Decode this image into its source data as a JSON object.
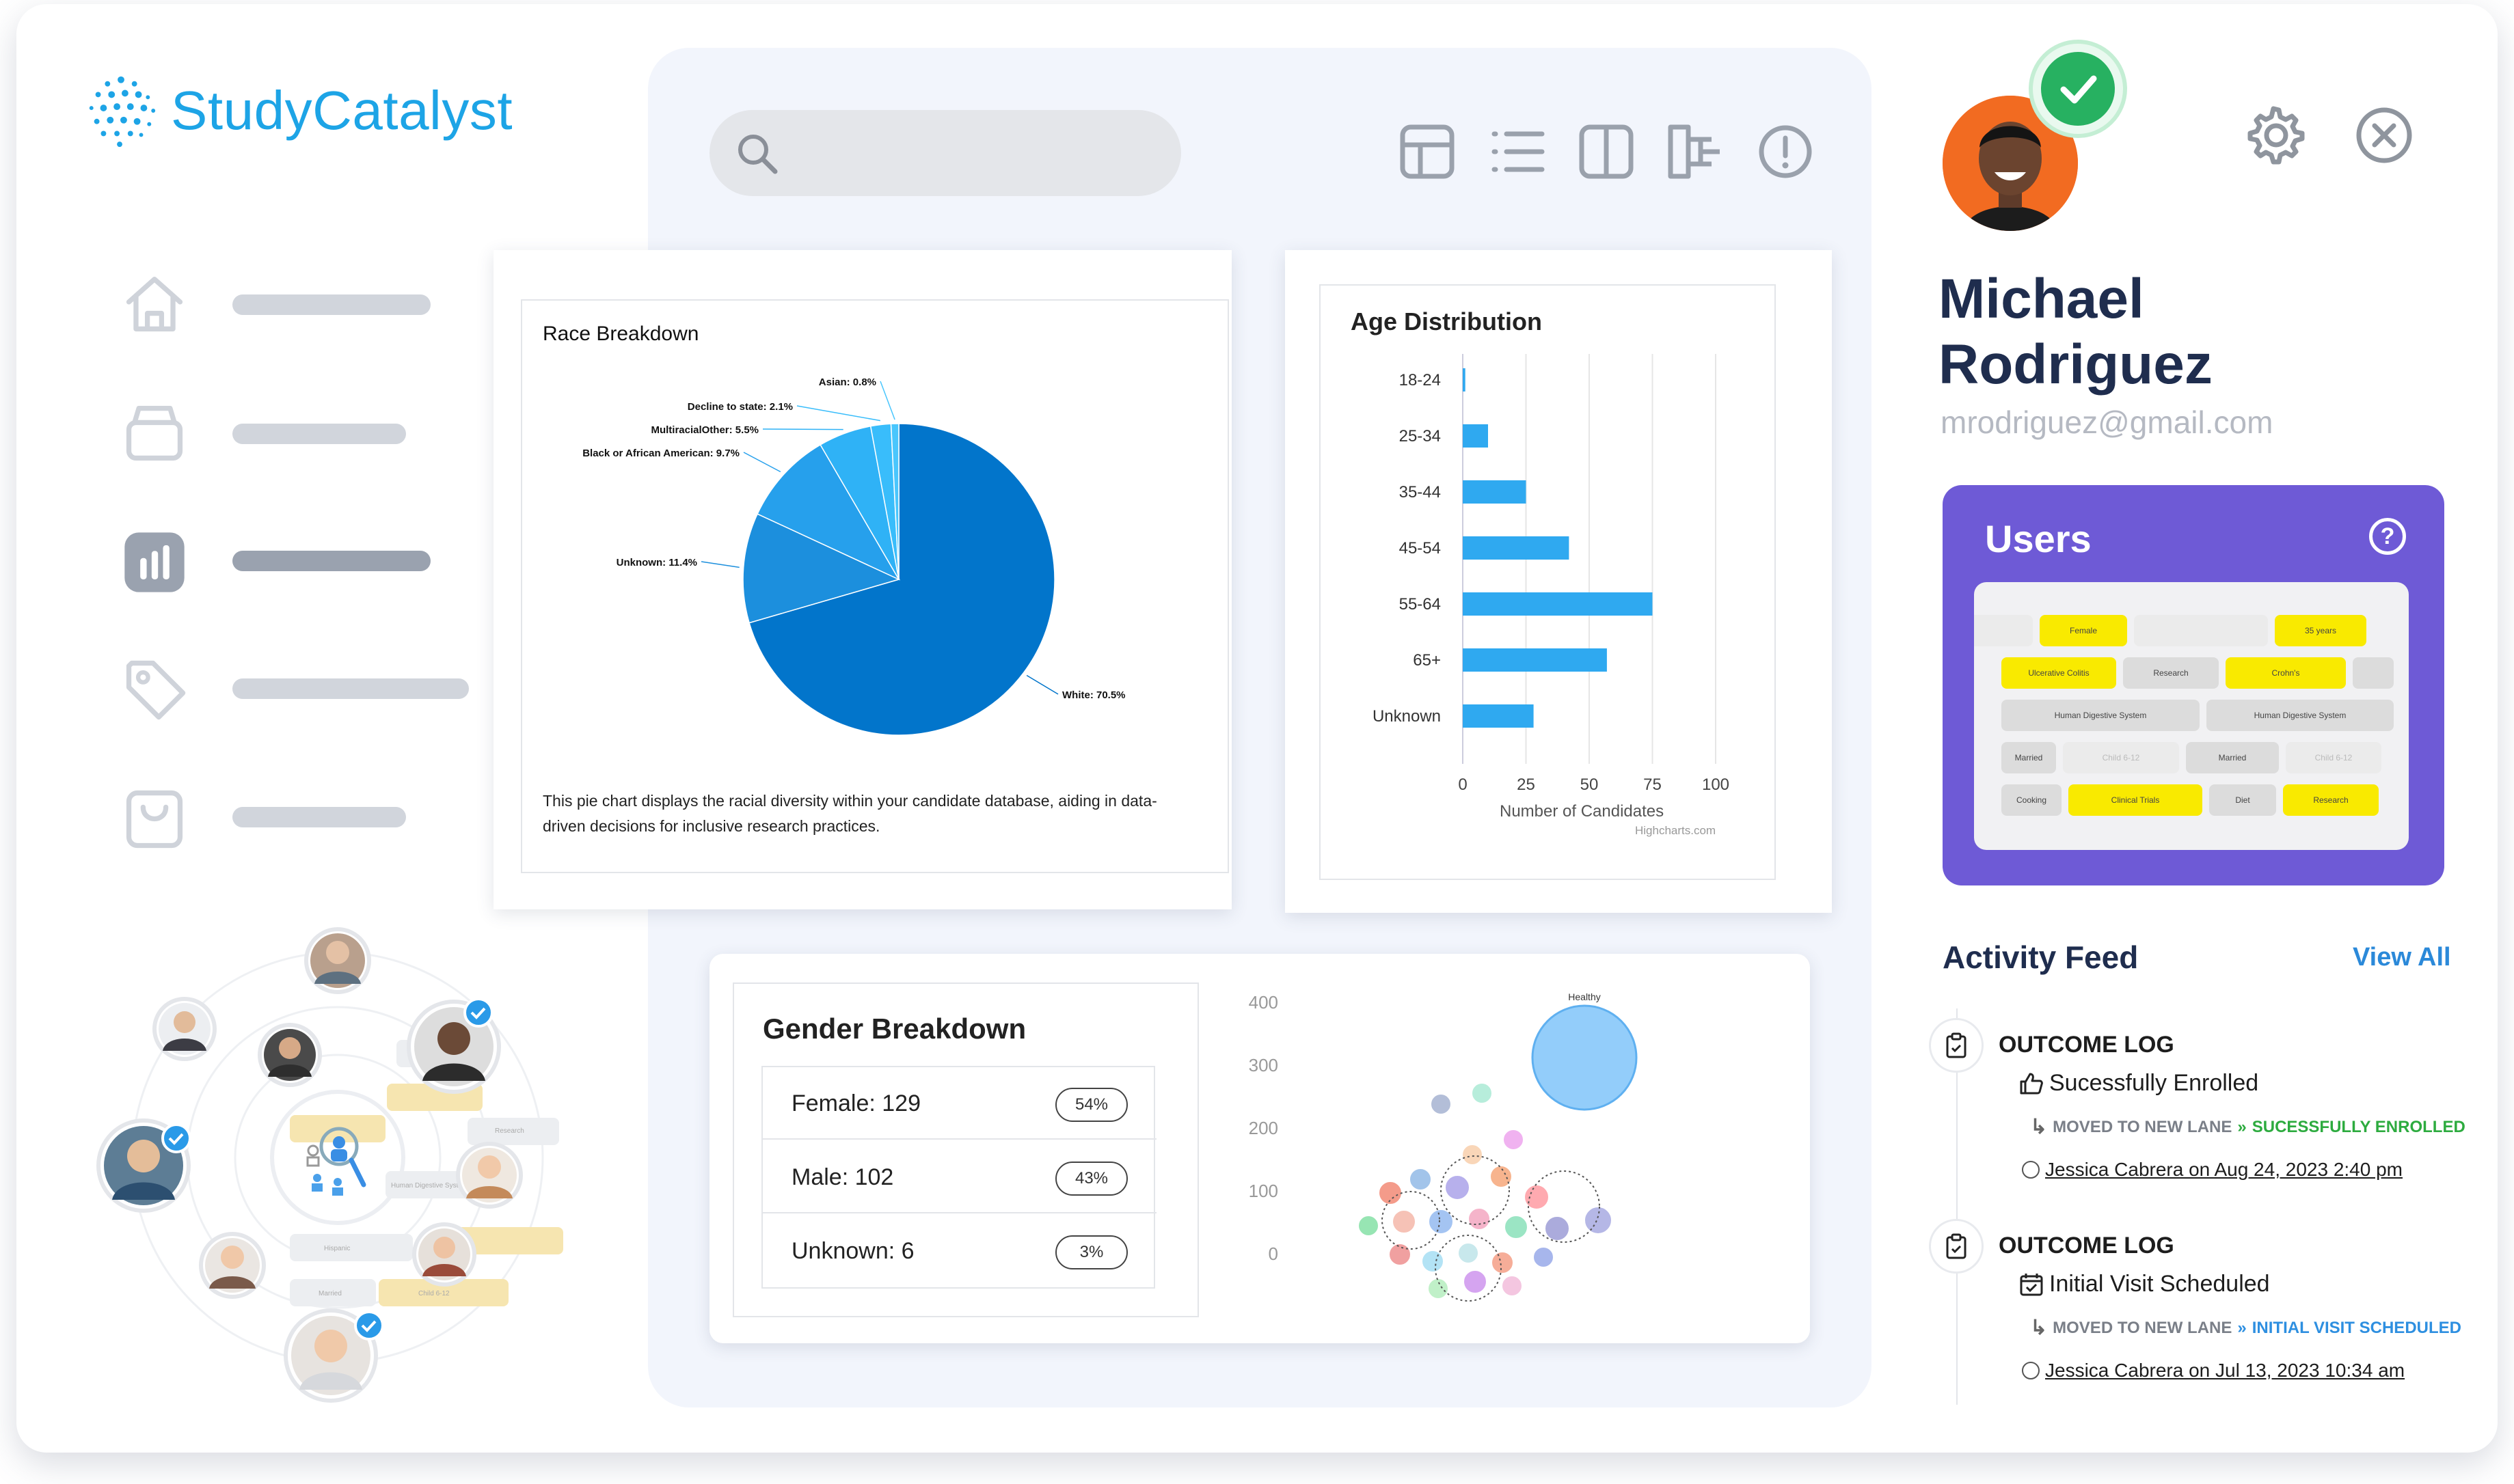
{
  "app": {
    "name": "StudyCatalyst"
  },
  "colors": {
    "brand": "#1da4e6",
    "accent_purple": "#6e5ad6",
    "pie_primary": "#0275cb",
    "bar": "#2fa9f0",
    "success": "#27b161"
  },
  "sidebar": {
    "items": [
      {
        "icon": "home-icon"
      },
      {
        "icon": "archive-icon"
      },
      {
        "icon": "chart-icon",
        "active": true
      },
      {
        "icon": "tag-icon"
      },
      {
        "icon": "shopping-bag-icon"
      }
    ]
  },
  "toolbar": {
    "icons": [
      "grid-icon",
      "list-icon",
      "columns-icon",
      "flowchart-icon",
      "alert-icon"
    ]
  },
  "race": {
    "title": "Race Breakdown",
    "description": "This pie chart displays the racial diversity within your candidate database, aiding in data-driven decisions for inclusive research practices.",
    "labels": {
      "white": "White: 70.5%",
      "unknown": "Unknown: 11.4%",
      "black": "Black or African American: 9.7%",
      "multi": "MultiracialOther: 5.5%",
      "decline": "Decline to state: 2.1%",
      "asian": "Asian: 0.8%"
    }
  },
  "age": {
    "title": "Age Distribution",
    "xlabel": "Number of Candidates",
    "credit": "Highcharts.com"
  },
  "gender": {
    "title": "Gender Breakdown",
    "rows": [
      {
        "label": "Female: 129",
        "pct": "54%"
      },
      {
        "label": "Male: 102",
        "pct": "43%"
      },
      {
        "label": "Unknown: 6",
        "pct": "3%"
      }
    ]
  },
  "bubble": {
    "yticks": [
      "400",
      "300",
      "200",
      "100",
      "0"
    ],
    "big_label": "Healthy"
  },
  "chart_data": [
    {
      "type": "pie",
      "title": "Race Breakdown",
      "categories": [
        "White",
        "Unknown",
        "Black or African American",
        "MultiracialOther",
        "Decline to state",
        "Asian"
      ],
      "values": [
        70.5,
        11.4,
        9.7,
        5.5,
        2.1,
        0.8
      ],
      "colors": [
        "#0275cb",
        "#1c8fdd",
        "#26a0ec",
        "#2fb2f6",
        "#39bdfb",
        "#49c6fd"
      ]
    },
    {
      "type": "bar",
      "title": "Age Distribution",
      "orientation": "horizontal",
      "categories": [
        "18-24",
        "25-34",
        "35-44",
        "45-54",
        "55-64",
        "65+",
        "Unknown"
      ],
      "values": [
        1,
        10,
        25,
        42,
        75,
        57,
        28
      ],
      "xlabel": "Number of Candidates",
      "xlim": [
        0,
        100
      ],
      "xticks": [
        0,
        25,
        50,
        75,
        100
      ],
      "grid": true
    }
  ],
  "profile": {
    "name_line1": "Michael",
    "name_line2": "Rodriguez",
    "email": "mrodriguez@gmail.com"
  },
  "users": {
    "title": "Users",
    "help": "?",
    "chips": [
      "Female",
      "35 years",
      "Ulcerative Colitis",
      "Research",
      "Crohn's",
      "Human Digestive System",
      "Human Digestive System",
      "Married",
      "Child 6-12",
      "Married",
      "Child 6-12",
      "Cooking",
      "Clinical Trials",
      "Diet",
      "Research"
    ]
  },
  "feed": {
    "title": "Activity Feed",
    "view_all": "View All",
    "entries": [
      {
        "head": "OUTCOME LOG",
        "sub": "Sucessfully Enrolled",
        "lane_prefix": "MOVED TO NEW LANE",
        "lane_target": "SUCESSFULLY ENROLLED",
        "by": "Jessica Cabrera on Aug 24, 2023 2:40 pm"
      },
      {
        "head": "OUTCOME LOG",
        "sub": "Initial Visit Scheduled",
        "lane_prefix": "MOVED TO NEW LANE",
        "lane_target": "INITIAL VISIT SCHEDULED",
        "by": "Jessica Cabrera on Jul 13, 2023 10:34 am"
      }
    ]
  },
  "network_tags": [
    "Research",
    "Hispanic",
    "Married",
    "Human Digestive System",
    "Child 6-12"
  ]
}
